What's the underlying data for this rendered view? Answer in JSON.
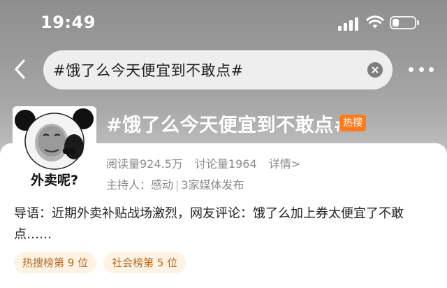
{
  "status_bar": {
    "time": "19:49",
    "signal_icon": "signal-bars-icon",
    "wifi_icon": "wifi-icon",
    "battery_icon": "battery-icon",
    "battery_level": 0.3
  },
  "header": {
    "back_icon": "chevron-left-icon",
    "search_value": "#饿了么今天便宜到不敢点#",
    "clear_icon": "clear-circle-icon",
    "more_icon": "more-horizontal-icon"
  },
  "topic": {
    "title": "#饿了么今天便宜到不敢点#",
    "hot_badge": "热搜",
    "avatar_caption": "外卖呢?",
    "stats": {
      "reads": "阅读量924.5万",
      "discussions": "讨论量1964",
      "details_link": "详情>"
    },
    "host": {
      "label": "主持人：感动",
      "separator": "|",
      "publishers": "3家媒体发布"
    },
    "summary": "导语：近期外卖补贴战场激烈，网友评论：饿了么加上券太便宜了不敢点……",
    "tags": [
      {
        "label": "热搜榜第 9 位"
      },
      {
        "label": "社会榜第 5 位"
      }
    ]
  },
  "colors": {
    "hot_badge_bg": "#ff7b1c",
    "tag_text": "#b96a1e",
    "tag_bg": "#fdf3e5"
  }
}
